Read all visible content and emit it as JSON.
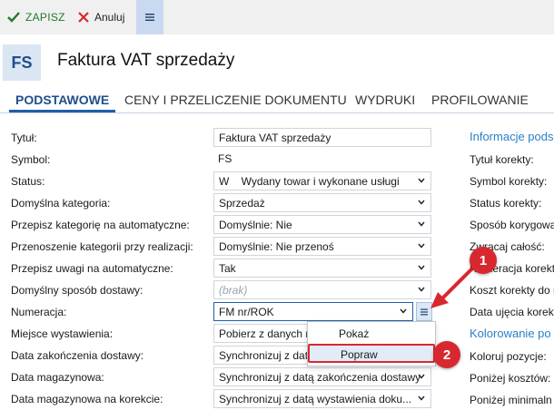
{
  "toolbar": {
    "save_label": "ZAPISZ",
    "cancel_label": "Anuluj"
  },
  "header": {
    "badge": "FS",
    "title": "Faktura VAT sprzedaży"
  },
  "tabs": [
    {
      "label": "PODSTAWOWE"
    },
    {
      "label": "CENY I PRZELICZENIE DOKUMENTU"
    },
    {
      "label": "WYDRUKI"
    },
    {
      "label": "PROFILOWANIE"
    }
  ],
  "form": {
    "rows": [
      {
        "label": "Tytuł:",
        "value": "Faktura VAT sprzedaży"
      },
      {
        "label": "Symbol:",
        "value": "FS"
      },
      {
        "label": "Status:",
        "value": "W    Wydany towar i wykonane usługi"
      },
      {
        "label": "Domyślna kategoria:",
        "value": "Sprzedaż"
      },
      {
        "label": "Przepisz kategorię na automatyczne:",
        "value": "Domyślnie: Nie"
      },
      {
        "label": "Przenoszenie kategorii przy realizacji:",
        "value": "Domyślnie: Nie przenoś"
      },
      {
        "label": "Przepisz uwagi na automatyczne:",
        "value": "Tak"
      },
      {
        "label": "Domyślny sposób dostawy:",
        "value": "(brak)"
      },
      {
        "label": "Numeracja:",
        "value": "FM nr/ROK"
      },
      {
        "label": "Miejsce wystawienia:",
        "value": "Pobierz z danych m"
      },
      {
        "label": "Data zakończenia dostawy:",
        "value": "Synchronizuj z dat"
      },
      {
        "label": "Data magazynowa:",
        "value": "Synchronizuj z datą zakończenia dostawy"
      },
      {
        "label": "Data magazynowa na korekcie:",
        "value": "Synchronizuj z datą wystawienia doku..."
      }
    ]
  },
  "right_panel": {
    "section1_title": "Informacje pods",
    "items": [
      "Tytuł korekty:",
      "Symbol korekty:",
      "Status korekty:",
      "Sposób korygowa",
      "Zwracaj całość:",
      "Numeracja korekt",
      "Koszt korekty do r",
      "Data ujęcia korekt"
    ],
    "section2_title": "Kolorowanie po",
    "items2": [
      "Koloruj pozycje:",
      "Poniżej kosztów:",
      "Poniżej minimaln"
    ]
  },
  "popup": {
    "items": [
      "Pokaż",
      "Popraw"
    ]
  },
  "callouts": [
    "1",
    "2"
  ],
  "colors": {
    "accent": "#1f5fa8",
    "save_green": "#1f7a2e",
    "callout_red": "#d8282f",
    "link_blue": "#2a7fc4"
  }
}
